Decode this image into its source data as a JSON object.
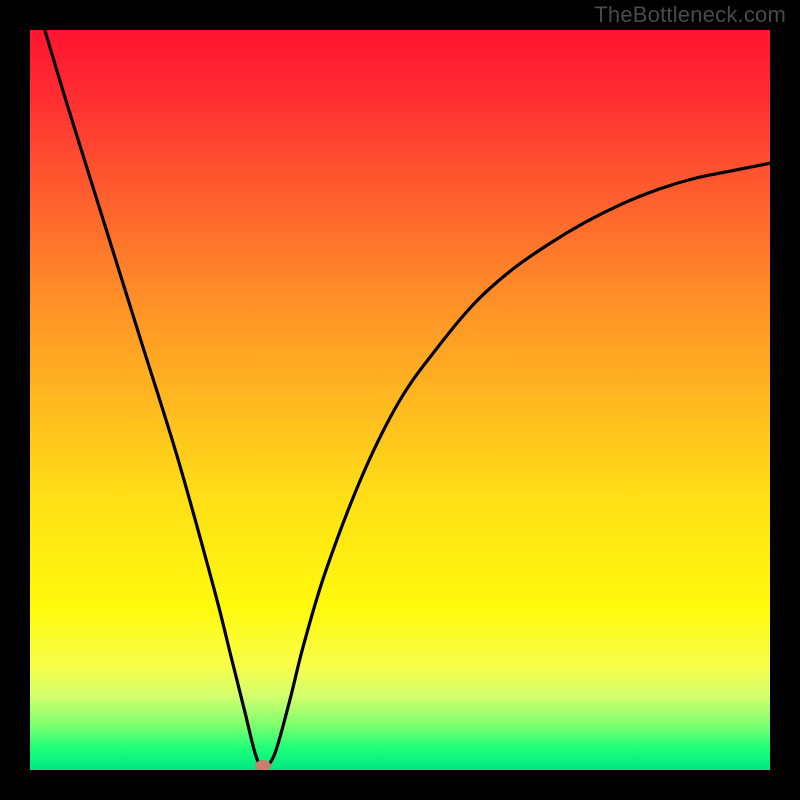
{
  "attribution": "TheBottleneck.com",
  "chart_data": {
    "type": "line",
    "title": "",
    "xlabel": "",
    "ylabel": "",
    "xlim": [
      0,
      100
    ],
    "ylim": [
      0,
      100
    ],
    "grid": false,
    "legend": false,
    "series": [
      {
        "name": "curve",
        "x": [
          2,
          5,
          10,
          15,
          20,
          25,
          27,
          29,
          30.5,
          31.5,
          33,
          35,
          37,
          40,
          45,
          50,
          55,
          60,
          65,
          70,
          75,
          80,
          85,
          90,
          95,
          100
        ],
        "y": [
          100,
          90,
          74,
          58,
          42,
          24,
          16,
          8,
          2,
          0.5,
          2,
          9,
          17,
          27,
          40,
          50,
          57,
          63,
          67.5,
          71,
          74,
          76.5,
          78.5,
          80,
          81,
          82
        ]
      }
    ],
    "marker": {
      "x": 31.5,
      "y": 0.5
    },
    "colors": {
      "curve": "#000000",
      "marker": "#c97e6e",
      "background_gradient_top": "#ff1430",
      "background_gradient_mid": "#ffe116",
      "background_gradient_bottom": "#00e884"
    }
  }
}
